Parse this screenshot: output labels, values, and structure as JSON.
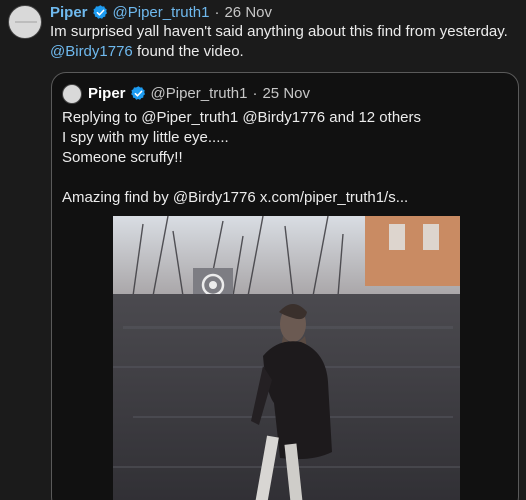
{
  "tweet": {
    "name": "Piper",
    "handle": "@Piper_truth1",
    "date": "26 Nov",
    "text_line1": "Im surprised yall haven't said anything about this find from yesterday.",
    "mention": "@Birdy1776",
    "text_line2_rest": " found the video."
  },
  "quote": {
    "name": "Piper",
    "handle": "@Piper_truth1",
    "date": "25 Nov",
    "lines": [
      "Replying to @Piper_truth1 @Birdy1776  and 12 others",
      "I spy with my little eye.....",
      "Someone scruffy!!",
      "",
      "Amazing find by @Birdy1776  x.com/piper_truth1/s..."
    ]
  },
  "separator": "·",
  "colors": {
    "link": "#6fb9ee",
    "verified": "#1d9bf0",
    "background": "#1b1b1b"
  },
  "icons": {
    "verified": "verified-badge-icon"
  }
}
